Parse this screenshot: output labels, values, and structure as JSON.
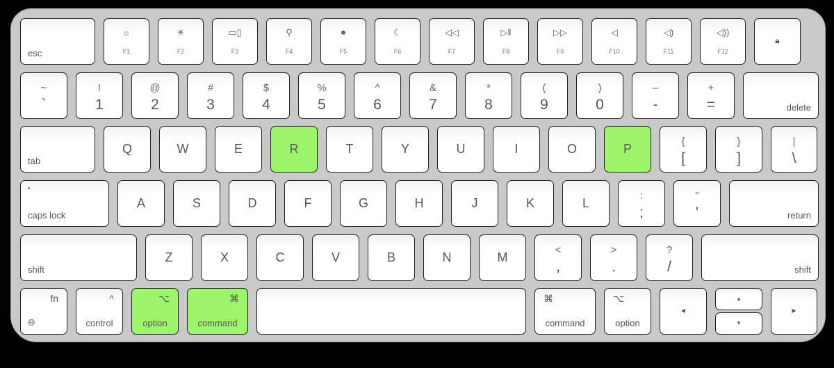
{
  "colors": {
    "highlight": "#9cf56a",
    "body": "#c9c9c9",
    "key": "#ffffff",
    "background": "#000000"
  },
  "rows": [
    [
      {
        "name": "esc",
        "bl": "esc"
      },
      {
        "name": "f1",
        "icon": "☼",
        "fn": "F1",
        "icon_name": "brightness-down-icon"
      },
      {
        "name": "f2",
        "icon": "☀",
        "fn": "F2",
        "icon_name": "brightness-up-icon"
      },
      {
        "name": "f3",
        "icon": "▭▯",
        "fn": "F3",
        "icon_name": "mission-control-icon"
      },
      {
        "name": "f4",
        "icon": "⚲",
        "fn": "F4",
        "icon_name": "search-icon"
      },
      {
        "name": "f5",
        "icon": "⏺",
        "fn": "F5",
        "icon_name": "microphone-icon"
      },
      {
        "name": "f6",
        "icon": "☾",
        "fn": "F6",
        "icon_name": "moon-icon"
      },
      {
        "name": "f7",
        "icon": "◁◁",
        "fn": "F7",
        "icon_name": "rewind-icon"
      },
      {
        "name": "f8",
        "icon": "▷‖",
        "fn": "F8",
        "icon_name": "play-pause-icon"
      },
      {
        "name": "f9",
        "icon": "▷▷",
        "fn": "F9",
        "icon_name": "fast-forward-icon"
      },
      {
        "name": "f10",
        "icon": "◁",
        "fn": "F10",
        "icon_name": "mute-icon"
      },
      {
        "name": "f11",
        "icon": "◁)",
        "fn": "F11",
        "icon_name": "volume-down-icon"
      },
      {
        "name": "f12",
        "icon": "◁))",
        "fn": "F12",
        "icon_name": "volume-up-icon"
      },
      {
        "name": "lock",
        "center": "🔒︎",
        "icon_name": "lock-icon"
      }
    ],
    [
      {
        "name": "backtick",
        "top": "~",
        "bot": "`"
      },
      {
        "name": "1",
        "top": "!",
        "bot": "1"
      },
      {
        "name": "2",
        "top": "@",
        "bot": "2"
      },
      {
        "name": "3",
        "top": "#",
        "bot": "3"
      },
      {
        "name": "4",
        "top": "$",
        "bot": "4"
      },
      {
        "name": "5",
        "top": "%",
        "bot": "5"
      },
      {
        "name": "6",
        "top": "^",
        "bot": "6"
      },
      {
        "name": "7",
        "top": "&",
        "bot": "7"
      },
      {
        "name": "8",
        "top": "*",
        "bot": "8"
      },
      {
        "name": "9",
        "top": "(",
        "bot": "9"
      },
      {
        "name": "0",
        "top": ")",
        "bot": "0"
      },
      {
        "name": "minus",
        "top": "–",
        "bot": "-"
      },
      {
        "name": "equals",
        "top": "+",
        "bot": "="
      },
      {
        "name": "delete",
        "br": "delete"
      }
    ],
    [
      {
        "name": "tab",
        "bl": "tab"
      },
      {
        "name": "q",
        "main": "Q"
      },
      {
        "name": "w",
        "main": "W"
      },
      {
        "name": "e",
        "main": "E"
      },
      {
        "name": "r",
        "main": "R",
        "highlighted": true
      },
      {
        "name": "t",
        "main": "T"
      },
      {
        "name": "y",
        "main": "Y"
      },
      {
        "name": "u",
        "main": "U"
      },
      {
        "name": "i",
        "main": "I"
      },
      {
        "name": "o",
        "main": "O"
      },
      {
        "name": "p",
        "main": "P",
        "highlighted": true
      },
      {
        "name": "bracket-left",
        "top": "{",
        "bot": "["
      },
      {
        "name": "bracket-right",
        "top": "}",
        "bot": "]"
      },
      {
        "name": "backslash",
        "top": "|",
        "bot": "\\"
      }
    ],
    [
      {
        "name": "caps-lock",
        "tl": "•",
        "bl": "caps lock"
      },
      {
        "name": "a",
        "main": "A"
      },
      {
        "name": "s",
        "main": "S"
      },
      {
        "name": "d",
        "main": "D"
      },
      {
        "name": "f",
        "main": "F"
      },
      {
        "name": "g",
        "main": "G"
      },
      {
        "name": "h",
        "main": "H"
      },
      {
        "name": "j",
        "main": "J"
      },
      {
        "name": "k",
        "main": "K"
      },
      {
        "name": "l",
        "main": "L"
      },
      {
        "name": "semicolon",
        "top": ":",
        "bot": ";"
      },
      {
        "name": "quote",
        "top": "\"",
        "bot": "'"
      },
      {
        "name": "return",
        "br": "return"
      }
    ],
    [
      {
        "name": "shift-left",
        "bl": "shift"
      },
      {
        "name": "z",
        "main": "Z"
      },
      {
        "name": "x",
        "main": "X"
      },
      {
        "name": "c",
        "main": "C"
      },
      {
        "name": "v",
        "main": "V"
      },
      {
        "name": "b",
        "main": "B"
      },
      {
        "name": "n",
        "main": "N"
      },
      {
        "name": "m",
        "main": "M"
      },
      {
        "name": "comma",
        "top": "<",
        "bot": ","
      },
      {
        "name": "period",
        "top": ">",
        "bot": "."
      },
      {
        "name": "slash",
        "top": "?",
        "bot": "/"
      },
      {
        "name": "shift-right",
        "br": "shift"
      }
    ],
    [
      {
        "name": "fn",
        "tr": "fn",
        "bl": "🌐︎"
      },
      {
        "name": "control",
        "tr": "^",
        "bc": "control"
      },
      {
        "name": "option-left",
        "tr": "⌥",
        "bc": "option",
        "highlighted": true
      },
      {
        "name": "command-left",
        "tr": "⌘",
        "bc": "command",
        "highlighted": true
      },
      {
        "name": "space"
      },
      {
        "name": "command-right",
        "tlb": "⌘",
        "bc": "command"
      },
      {
        "name": "option-right",
        "tlb": "⌥",
        "bc": "option"
      },
      {
        "name": "arrow-left",
        "center": "◂"
      },
      {
        "name": "arrow-up-down",
        "up": "▴",
        "down": "▾"
      },
      {
        "name": "arrow-right",
        "center": "▸"
      }
    ]
  ]
}
